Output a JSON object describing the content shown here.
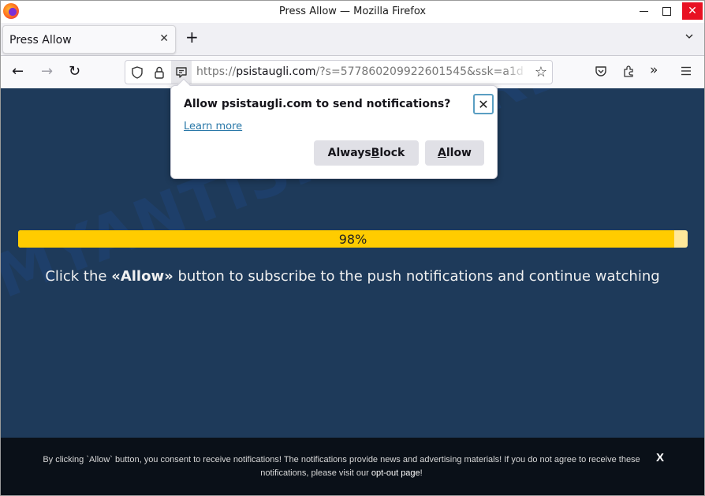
{
  "window": {
    "title": "Press Allow — Mozilla Firefox",
    "controls": {
      "minimize": "minimize",
      "maximize": "maximize",
      "close": "✕"
    }
  },
  "tabs": [
    {
      "label": "Press Allow",
      "close": "✕",
      "active": true
    }
  ],
  "tabbar": {
    "new_tab": "+",
    "list_all_tabs": "chevron-down"
  },
  "navbar": {
    "back": "←",
    "forward": "→",
    "reload": "↻",
    "url_scheme": "https://",
    "url_host": "psistaugli.com",
    "url_rest": "/?s=577860209922601545&ssk=a1d",
    "bookmark": "☆",
    "overflow": "»",
    "icons": [
      "shield-icon",
      "lock-icon",
      "notification-permission-icon",
      "pocket-icon",
      "extensions-icon",
      "overflow-icon",
      "menu-icon"
    ]
  },
  "popup": {
    "title": "Allow psistaugli.com to send notifications?",
    "learn_more": "Learn more",
    "close": "✕",
    "block_pre": "Always ",
    "block_key": "B",
    "block_post": "lock",
    "allow_key": "A",
    "allow_post": "llow"
  },
  "page": {
    "progress_percent": 98,
    "progress_label": "98%",
    "instruction_pre": "Click the ",
    "instruction_bold": "«Allow»",
    "instruction_post": " button to subscribe to the push notifications and continue watching",
    "watermark": "MYANTISPYWARE.COM"
  },
  "banner": {
    "text": "By clicking `Allow` button, you consent to receive notifications! The notifications provide news and advertising materials! If you do not agree to receive these notifications, please visit our ",
    "link": "opt-out page",
    "text_end": "!",
    "close": "X"
  },
  "colors": {
    "page_background": "#1e3a5a",
    "progress_fill": "#ffcc00",
    "progress_track": "#ffe89a",
    "banner_background": "#0a1018",
    "window_close": "#e81123",
    "link": "#2a78a8"
  }
}
